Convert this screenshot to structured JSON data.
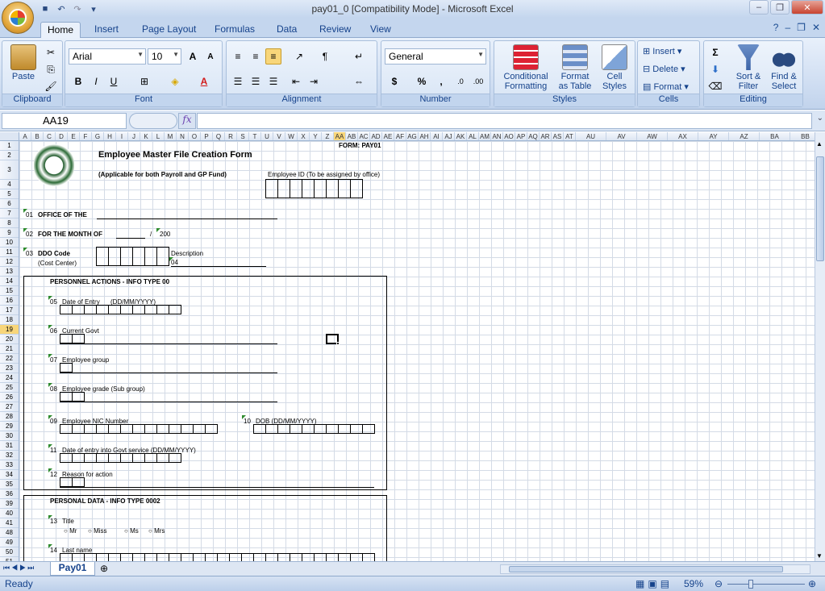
{
  "window": {
    "title": "pay01_0  [Compatibility Mode] - Microsoft Excel"
  },
  "tabs": [
    "Home",
    "Insert",
    "Page Layout",
    "Formulas",
    "Data",
    "Review",
    "View"
  ],
  "ribbon": {
    "clipboard": {
      "label": "Clipboard",
      "paste": "Paste"
    },
    "font": {
      "label": "Font",
      "name": "Arial",
      "size": "10",
      "grow": "A",
      "shrink": "A",
      "bold": "B",
      "italic": "I",
      "underline": "U",
      "color_letter": "A"
    },
    "alignment": {
      "label": "Alignment"
    },
    "number": {
      "label": "Number",
      "format": "General",
      "currency": "$",
      "percent": "%",
      "comma": ","
    },
    "styles": {
      "label": "Styles",
      "conditional": "Conditional",
      "conditional2": "Formatting",
      "format_table": "Format",
      "format_table2": "as Table",
      "cell_styles": "Cell",
      "cell_styles2": "Styles"
    },
    "cells": {
      "label": "Cells",
      "insert": "Insert",
      "delete": "Delete",
      "format": "Format"
    },
    "editing": {
      "label": "Editing",
      "sigma": "Σ",
      "sort": "Sort &",
      "sort2": "Filter",
      "find": "Find &",
      "find2": "Select"
    }
  },
  "formula_bar": {
    "name_box": "AA19",
    "fx": "fx",
    "formula": ""
  },
  "columns": [
    "A",
    "B",
    "C",
    "D",
    "E",
    "F",
    "G",
    "H",
    "I",
    "J",
    "K",
    "L",
    "M",
    "N",
    "O",
    "P",
    "Q",
    "R",
    "S",
    "T",
    "U",
    "V",
    "W",
    "X",
    "Y",
    "Z",
    "AA",
    "AB",
    "AC",
    "AD",
    "AE",
    "AF",
    "AG",
    "AH",
    "AI",
    "AJ",
    "AK",
    "AL",
    "AM",
    "AN",
    "AO",
    "AP",
    "AQ",
    "AR",
    "AS",
    "AT",
    "AU",
    "AV",
    "AW",
    "AX",
    "AY",
    "AZ",
    "BA",
    "BB",
    "BC"
  ],
  "selected_column": "AA",
  "rows": [
    "1",
    "2",
    "3",
    "4",
    "5",
    "6",
    "7",
    "8",
    "9",
    "10",
    "11",
    "12",
    "13",
    "14",
    "15",
    "16",
    "17",
    "18",
    "19",
    "20",
    "21",
    "22",
    "23",
    "24",
    "25",
    "26",
    "27",
    "28",
    "29",
    "30",
    "31",
    "32",
    "33",
    "34",
    "35",
    "36",
    "39",
    "40",
    "41",
    "48",
    "49",
    "50",
    "51",
    "52",
    "53",
    "54",
    "55"
  ],
  "selected_row": "19",
  "form": {
    "form_id": "FORM: PAY01",
    "title": "Employee Master File Creation Form",
    "subtitle": "(Applicable for both Payroll and GP Fund)",
    "employee_id": "Employee ID (To be assigned by office)",
    "f01": "01",
    "office": "OFFICE OF THE",
    "f02": "02",
    "month": "FOR THE MONTH OF",
    "slash": "/",
    "year": "200",
    "f03": "03",
    "ddo": "DDO Code",
    "cost_center": "(Cost Center)",
    "description": "Description",
    "f04": "04",
    "personnel": "PERSONNEL ACTIONS - INFO TYPE 00",
    "f05": "05",
    "date_entry": "Date of Entry",
    "date_fmt": "(DD/MM/YYYY)",
    "f06": "06",
    "current_govt": "Current Govt",
    "f07": "07",
    "emp_group": "Employee group",
    "f08": "08",
    "emp_grade": "Employee grade (Sub group)",
    "f09": "09",
    "nic": "Employee NIC Number",
    "f10": "10",
    "dob": "DOB (DD/MM/YYYY)",
    "f11": "11",
    "govt_entry": "Date of entry into Govt service (DD/MM/YYYY)",
    "f12": "12",
    "reason": "Reason for action",
    "personal": "PERSONAL DATA - INFO TYPE 0002",
    "f13": "13",
    "title_label": "Title",
    "titles": [
      "Mr",
      "Miss",
      "Ms",
      "Mrs"
    ],
    "f14": "14",
    "last_name": "Last name"
  },
  "sheet": {
    "tab": "Pay01"
  },
  "status": {
    "text": "Ready",
    "zoom": "59%"
  }
}
